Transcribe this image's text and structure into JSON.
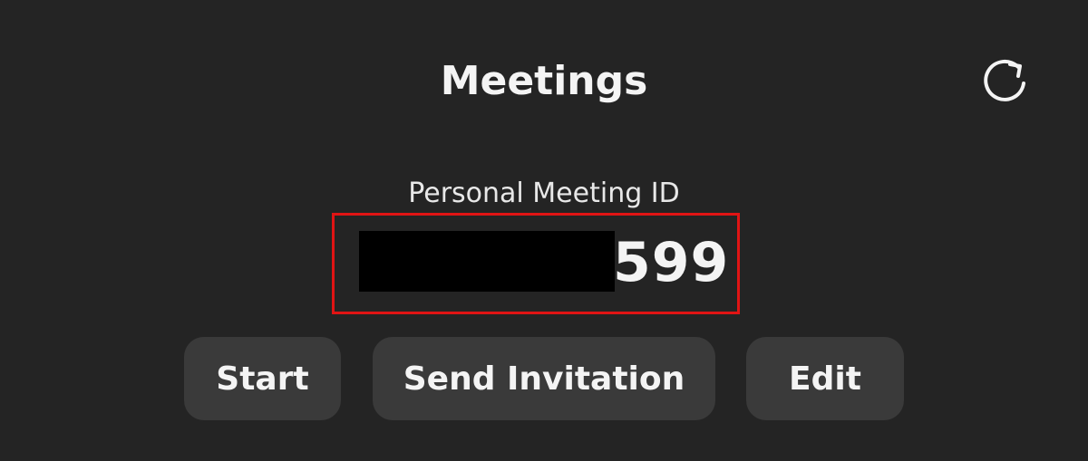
{
  "header": {
    "title": "Meetings",
    "refresh_icon": "refresh-icon"
  },
  "personal_meeting": {
    "label": "Personal Meeting ID",
    "id_visible_suffix": "599",
    "highlight_color": "#e01414"
  },
  "actions": {
    "start_label": "Start",
    "send_invitation_label": "Send Invitation",
    "edit_label": "Edit"
  },
  "colors": {
    "background": "#242424",
    "button_background": "#3a3a3a",
    "text": "#f4f4f4"
  }
}
